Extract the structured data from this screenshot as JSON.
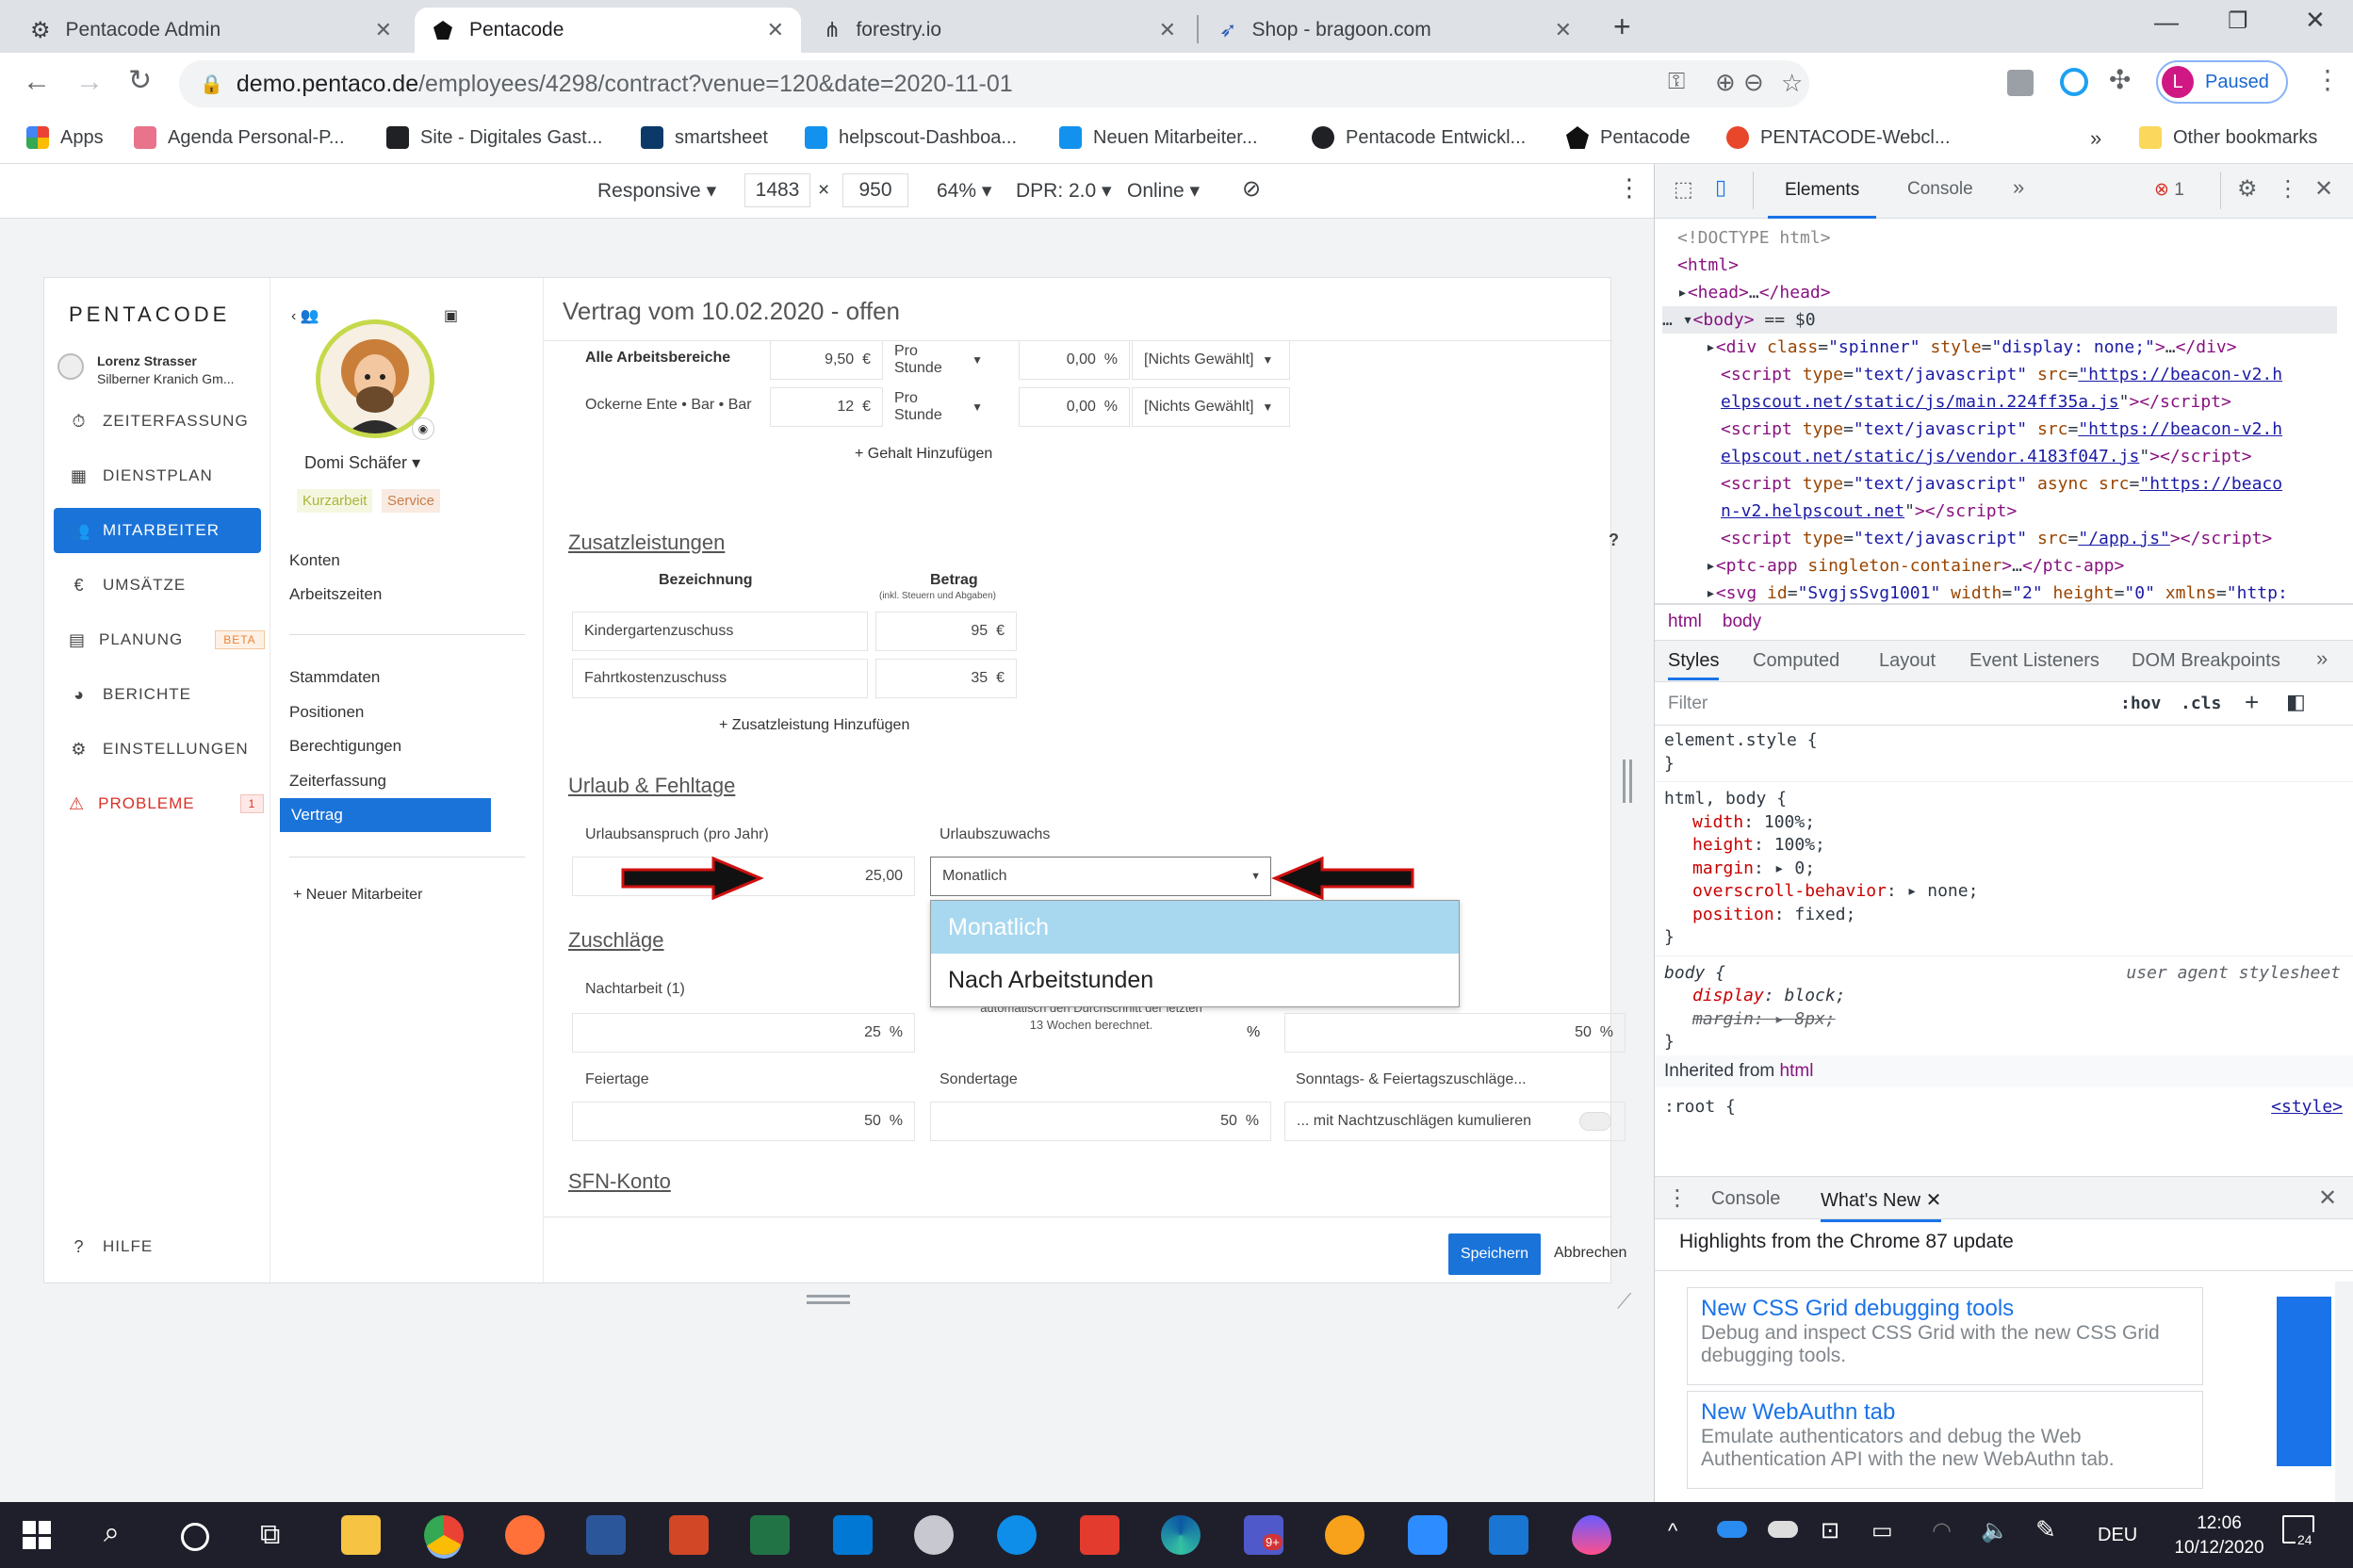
{
  "browser": {
    "tabs": [
      {
        "title": "Pentacode Admin"
      },
      {
        "title": "Pentacode"
      },
      {
        "title": "forestry.io"
      },
      {
        "title": "Shop - bragoon.com"
      }
    ],
    "url_host": "demo.pentaco.de",
    "url_path": "/employees/4298/contract?venue=120&date=2020-11-01",
    "profile_initial": "L",
    "profile_status": "Paused",
    "bookmarks": [
      "Apps",
      "Agenda Personal-P...",
      "Site - Digitales Gast...",
      "smartsheet",
      "helpscout-Dashboa...",
      "Neuen Mitarbeiter...",
      "Pentacode Entwickl...",
      "Pentacode",
      "PENTACODE-Webcl..."
    ],
    "other_bookmarks": "Other bookmarks"
  },
  "device_toolbar": {
    "mode": "Responsive",
    "width": "1483",
    "height": "950",
    "zoom": "64%",
    "dpr": "DPR: 2.0",
    "network": "Online"
  },
  "app": {
    "logo": "PENTACODE",
    "user_name": "Lorenz Strasser",
    "user_company": "Silberner Kranich Gm...",
    "nav": [
      {
        "label": "ZEITERFASSUNG",
        "icon": "stopwatch-icon"
      },
      {
        "label": "DIENSTPLAN",
        "icon": "grid-icon"
      },
      {
        "label": "MITARBEITER",
        "icon": "users-icon"
      },
      {
        "label": "UMSÄTZE",
        "icon": "euro-icon"
      },
      {
        "label": "PLANUNG",
        "icon": "calendar-icon",
        "badge": "BETA"
      },
      {
        "label": "BERICHTE",
        "icon": "pie-chart-icon"
      },
      {
        "label": "EINSTELLUNGEN",
        "icon": "gear-icon"
      },
      {
        "label": "PROBLEME",
        "icon": "warning-icon",
        "badge": "1"
      }
    ],
    "help": "HILFE",
    "employee": {
      "name": "Domi Schäfer",
      "tag1": "Kurzarbeit",
      "tag2": "Service"
    },
    "sub_nav_top": [
      "Konten",
      "Arbeitszeiten"
    ],
    "sub_nav": [
      "Stammdaten",
      "Positionen",
      "Berechtigungen",
      "Zeiterfassung",
      "Vertrag"
    ],
    "new_employee": "Neuer Mitarbeiter",
    "title": "Vertrag vom 10.02.2020 - offen",
    "salary_rows": [
      {
        "area": "Alle Arbeitsbereiche",
        "amount": "9,50",
        "currency": "€",
        "unit": "Pro Stunde",
        "pct": "0,00",
        "pct_unit": "%",
        "choice": "[Nichts Gewählt]"
      },
      {
        "area": "Ockerne Ente • Bar • Bar",
        "amount": "12",
        "currency": "€",
        "unit": "Pro Stunde",
        "pct": "0,00",
        "pct_unit": "%",
        "choice": "[Nichts Gewählt]"
      }
    ],
    "add_salary": "Gehalt Hinzufügen",
    "zusatz_title": "Zusatzleistungen",
    "zusatz_help": "?",
    "zusatz_col1": "Bezeichnung",
    "zusatz_col2": "Betrag",
    "zusatz_col2_sub": "(inkl. Steuern und Abgaben)",
    "zusatz_rows": [
      {
        "name": "Kindergartenzuschuss",
        "amount": "95",
        "currency": "€"
      },
      {
        "name": "Fahrtkostenzuschuss",
        "amount": "35",
        "currency": "€"
      }
    ],
    "add_zusatz": "Zusatzleistung Hinzufügen",
    "urlaub_title": "Urlaub & Fehltage",
    "urlaub_label": "Urlaubsanspruch (pro Jahr)",
    "urlaub_value": "25,00",
    "zuwachs_label": "Urlaubszuwachs",
    "zuwachs_value": "Monatlich",
    "dropdown_options": [
      "Monatlich",
      "Nach Arbeitstunden"
    ],
    "zuschlaege_title": "Zuschläge",
    "nacht_label": "Nachtarbeit (1)",
    "nacht_value": "25",
    "hint_text_1": "automatisch den Durchschnitt der letzten",
    "hint_text_2": "13 Wochen berechnet.",
    "pct": "%",
    "third_value": "50",
    "feiertage_label": "Feiertage",
    "feiertage_value": "50",
    "sondertage_label": "Sondertage",
    "sondertage_value": "50",
    "sonntag_label": "Sonntags- & Feiertagszuschläge...",
    "kumulieren_label": "... mit Nachtzuschlägen kumulieren",
    "sfn_title": "SFN-Konto",
    "save": "Speichern",
    "cancel": "Abbrechen"
  },
  "devtools": {
    "tabs": [
      "Elements",
      "Console"
    ],
    "errors": "1",
    "crumbs": [
      "html",
      "body"
    ],
    "style_tabs": [
      "Styles",
      "Computed",
      "Layout",
      "Event Listeners",
      "DOM Breakpoints"
    ],
    "filter_placeholder": "Filter",
    "hov": ":hov",
    "cls": ".cls",
    "inherited_label": "Inherited from",
    "inherited_tag": "html",
    "ua_label": "user agent stylesheet",
    "style_label": "<style>",
    "drawer_tabs": [
      "Console",
      "What's New"
    ],
    "highlights": "Highlights from the Chrome 87 update",
    "news": [
      {
        "title": "New CSS Grid debugging tools",
        "body": "Debug and inspect CSS Grid with the new CSS Grid debugging tools."
      },
      {
        "title": "New WebAuthn tab",
        "body": "Emulate authenticators and debug the Web Authentication API with the new WebAuthn tab."
      }
    ]
  },
  "taskbar": {
    "lang": "DEU",
    "time": "12:06",
    "date": "10/12/2020",
    "notif": "24",
    "teams_badge": "9+"
  },
  "colors": {
    "accent": "#1a73d9",
    "chrome_tab": "#dee1e6",
    "dropdown_highlight": "#a8d8ef",
    "danger": "#d93025",
    "taskbar": "#1f1f2b"
  }
}
